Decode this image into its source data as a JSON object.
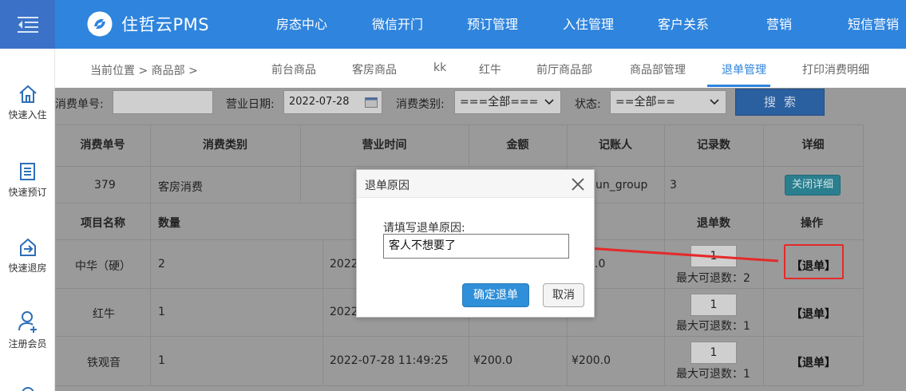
{
  "header": {
    "logo_text": "住哲云PMS",
    "nav": [
      "房态中心",
      "微信开门",
      "预订管理",
      "入住管理",
      "客户关系",
      "营销",
      "短信营销"
    ]
  },
  "sidebar": {
    "items": [
      {
        "label": "快速入住",
        "icon": "home-icon"
      },
      {
        "label": "快速预订",
        "icon": "booking-icon"
      },
      {
        "label": "快速退房",
        "icon": "checkout-icon"
      },
      {
        "label": "注册会员",
        "icon": "add-member-icon"
      }
    ]
  },
  "breadcrumb": {
    "text": "当前位置 > 商品部 >"
  },
  "tabs": [
    "前台商品",
    "客房商品",
    "kk",
    "红牛",
    "前厅商品部",
    "商品部管理",
    "退单管理",
    "打印消费明细"
  ],
  "active_tab": "退单管理",
  "filter": {
    "order_no_label": "消费单号:",
    "order_no_value": "",
    "biz_date_label": "营业日期:",
    "biz_date_value": "2022-07-28",
    "category_label": "消费类别:",
    "category_value": "===全部===",
    "status_label": "状态:",
    "status_value": "==全部==",
    "search_label": "搜索"
  },
  "table": {
    "headers": [
      "消费单号",
      "消费类别",
      "营业时间",
      "金额",
      "记账人",
      "记录数",
      "详细"
    ],
    "order_row": {
      "order_no": "379",
      "category": "客房消费",
      "recorder": "un_group",
      "count": "3",
      "detail_btn": "关闭详细"
    },
    "sub_headers": {
      "item_name": "项目名称",
      "qty": "数量",
      "return_qty": "退单数",
      "action": "操作"
    },
    "items": [
      {
        "name": "中华（硬）",
        "qty": "2",
        "time": "2022",
        "amount": "",
        "amount2": ".0",
        "return_qty": "1",
        "max_text": "最大可退数：2",
        "action": "【退单】"
      },
      {
        "name": "红牛",
        "qty": "1",
        "time": "2022",
        "amount": "",
        "amount2": "",
        "return_qty": "1",
        "max_text": "最大可退数：1",
        "action": "【退单】"
      },
      {
        "name": "铁观音",
        "qty": "1",
        "time": "2022-07-28 11:49:25",
        "amount": "¥200.0",
        "amount2": "¥200.0",
        "return_qty": "1",
        "max_text": "最大可退数：1",
        "action": "【退单】"
      }
    ]
  },
  "dialog": {
    "title": "退单原因",
    "prompt": "请填写退单原因:",
    "reason_value": "客人不想要了",
    "confirm_label": "确定退单",
    "cancel_label": "取消"
  },
  "colors": {
    "header_bg": "#2f84dd",
    "active_tab": "#2f84dd",
    "annotation": "#e52a2a"
  }
}
